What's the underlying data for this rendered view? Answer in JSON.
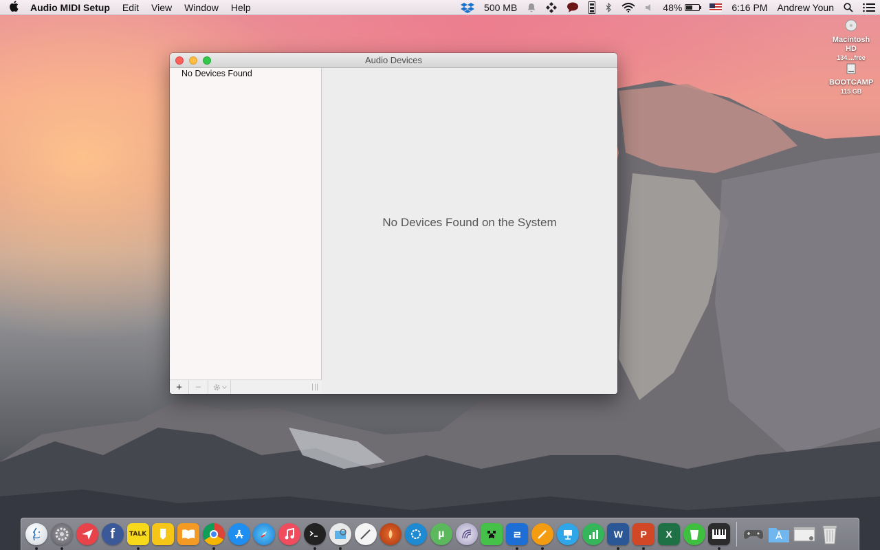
{
  "menubar": {
    "app_name": "Audio MIDI Setup",
    "menus": [
      "Edit",
      "View",
      "Window",
      "Help"
    ],
    "status": {
      "memory": "500 MB",
      "battery": "48%",
      "battery_level": 0.48,
      "time": "6:16 PM",
      "user": "Andrew Youn"
    }
  },
  "desktop": {
    "drives": [
      {
        "name": "Macintosh HD",
        "info": "134....free"
      },
      {
        "name": "BOOTCAMP",
        "info": "115 GB"
      }
    ]
  },
  "window": {
    "title": "Audio Devices",
    "sidebar": {
      "items": [
        "No Devices Found"
      ],
      "toolbar": {
        "add": "+",
        "remove": "−"
      }
    },
    "main": {
      "empty_message": "No Devices Found on the System"
    }
  },
  "dock": {
    "icon_label_talk": "TALK"
  }
}
